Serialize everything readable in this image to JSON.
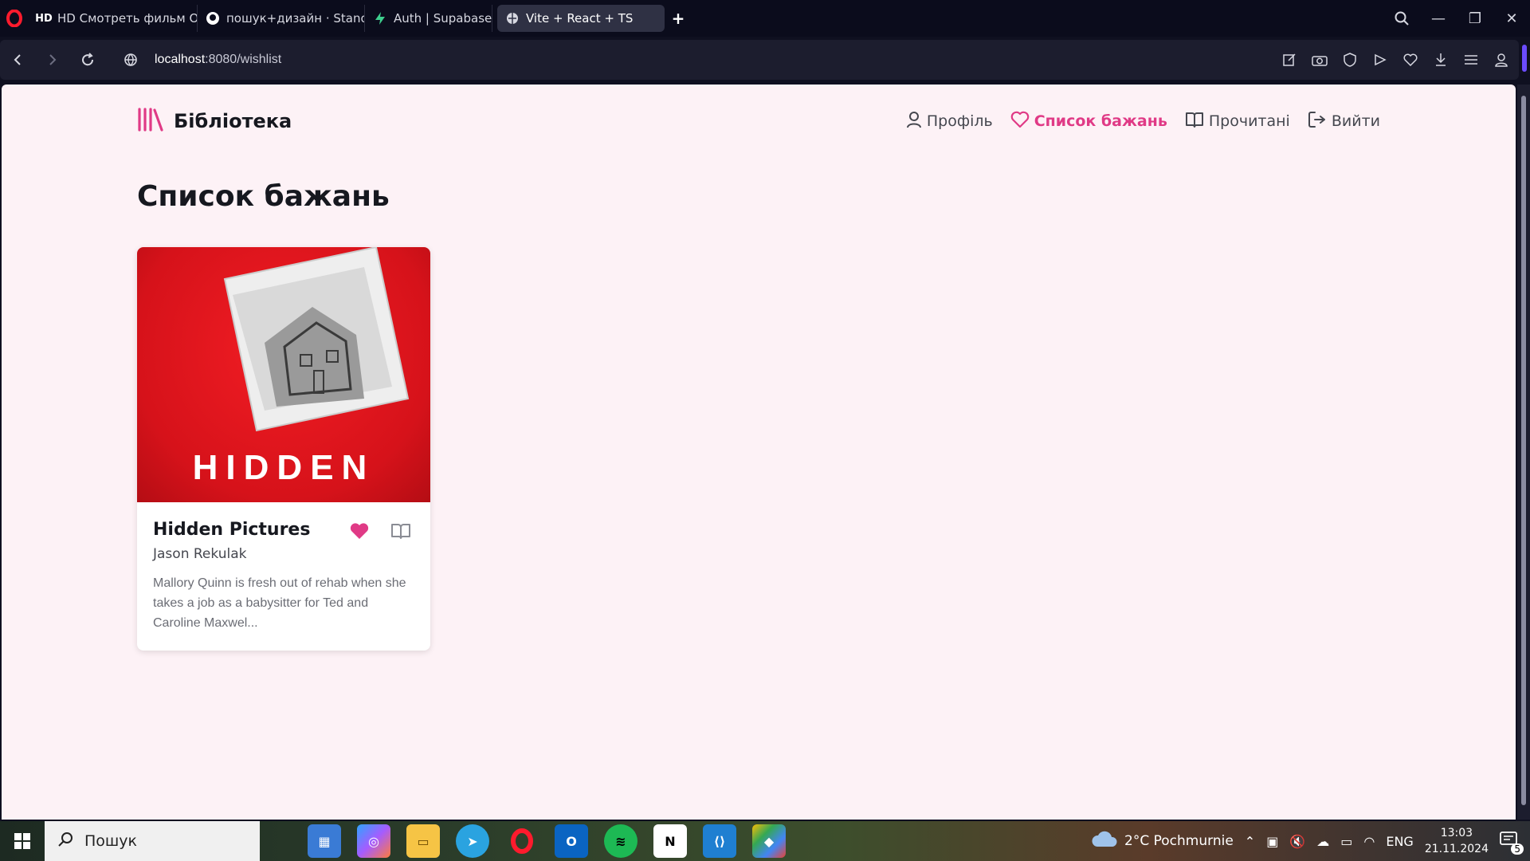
{
  "browser": {
    "tabs": [
      {
        "label": "HD Смотреть фильм Омен он",
        "icon": "hd-icon"
      },
      {
        "label": "пошук+дизайн · Stanovsk",
        "icon": "github-icon"
      },
      {
        "label": "Auth | Supabase",
        "icon": "supabase-icon"
      },
      {
        "label": "Vite + React + TS",
        "icon": "globe-icon",
        "active": true
      }
    ],
    "url_host": "localhost",
    "url_path": ":8080/wishlist"
  },
  "app": {
    "brand": "Бібліотека",
    "nav": [
      {
        "label": "Профіль",
        "icon": "user-icon"
      },
      {
        "label": "Список бажань",
        "icon": "heart-icon",
        "active": true
      },
      {
        "label": "Прочитані",
        "icon": "book-open-icon"
      },
      {
        "label": "Вийти",
        "icon": "logout-icon"
      }
    ],
    "page_title": "Список бажань",
    "colors": {
      "accent": "#e03a86",
      "background": "#fdf2f6"
    }
  },
  "books": [
    {
      "cover_text": "HIDDEN",
      "title": "Hidden Pictures",
      "author": "Jason Rekulak",
      "description": "Mallory Quinn is fresh out of rehab when she takes a job as a babysitter for Ted and Caroline Maxwel..."
    }
  ],
  "taskbar": {
    "search_placeholder": "Пошук",
    "weather": "2°C  Pochmurnie",
    "language": "ENG",
    "time": "13:03",
    "date": "21.11.2024",
    "notifications": "5"
  }
}
